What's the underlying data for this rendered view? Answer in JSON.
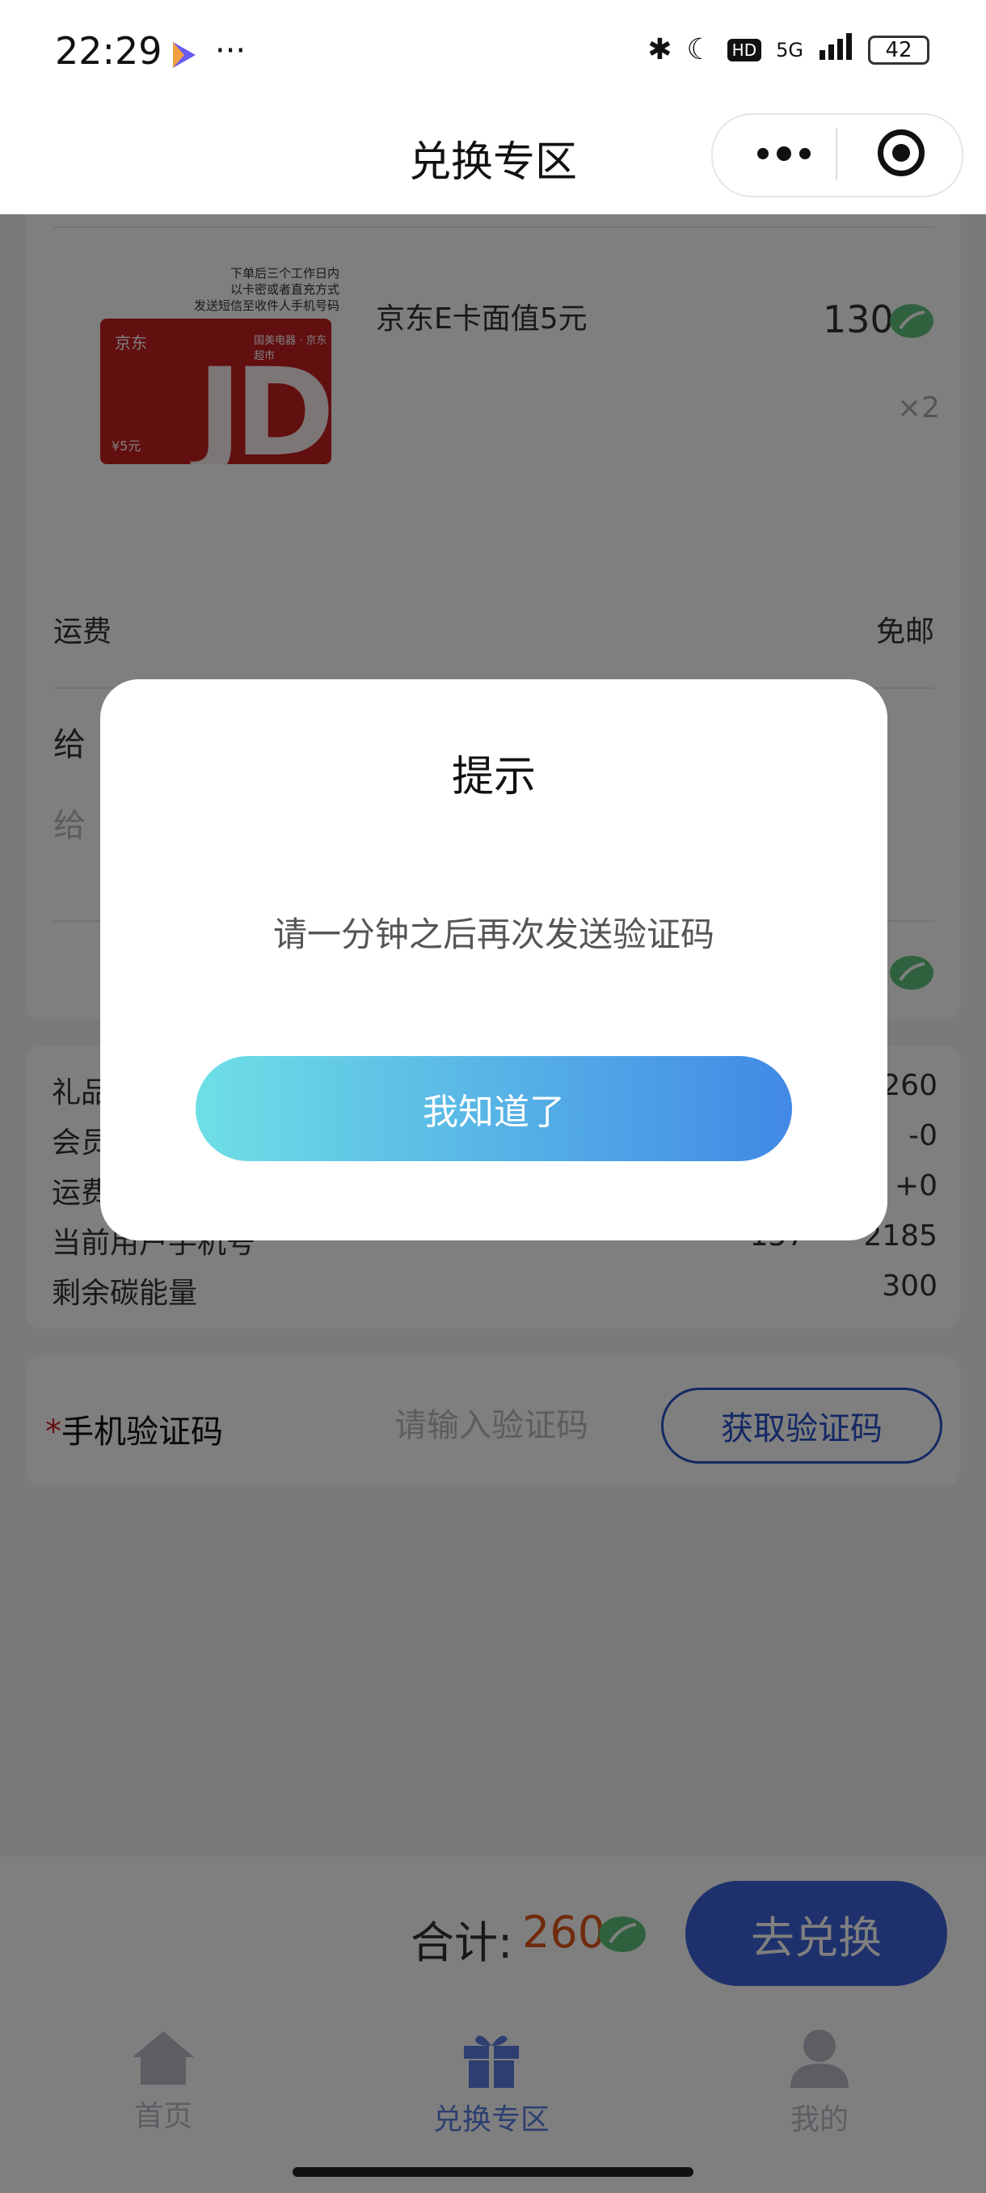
{
  "status": {
    "time": "22:29",
    "battery": "42",
    "network": "5G",
    "hd": "HD"
  },
  "nav": {
    "title": "兑换专区"
  },
  "product": {
    "card_note": [
      "下单后三个工作日内",
      "以卡密或者直充方式",
      "发送短信至收件人手机号码"
    ],
    "card_logo": "京东",
    "card_brand": "JD",
    "card_value_small": "¥5元",
    "card_tags": "国美电器 · 京东超市",
    "name": "京东E卡面值5元",
    "price": "130",
    "quantity": "×2"
  },
  "shipping": {
    "label": "运费",
    "value": "免邮"
  },
  "message": {
    "label": "给",
    "placeholder": "给"
  },
  "summary": {
    "rows": [
      {
        "label": "礼品",
        "value": "260"
      },
      {
        "label": "会员",
        "value": "-0"
      },
      {
        "label": "运费",
        "value": "+0"
      },
      {
        "label": "当前用户手机号",
        "value": "157****2185"
      },
      {
        "label": "剩余碳能量",
        "value": "300"
      }
    ]
  },
  "verify": {
    "star": "*",
    "label": "手机验证码",
    "placeholder": "请输入验证码",
    "button": "获取验证码"
  },
  "checkout": {
    "total_label": "合计:",
    "total_value": "260",
    "button": "去兑换"
  },
  "tabs": [
    {
      "label": "首页",
      "active": false,
      "icon": "home-icon"
    },
    {
      "label": "兑换专区",
      "active": true,
      "icon": "gift-icon"
    },
    {
      "label": "我的",
      "active": false,
      "icon": "user-icon"
    }
  ],
  "dialog": {
    "title": "提示",
    "message": "请一分钟之后再次发送验证码",
    "button": "我知道了"
  },
  "colors": {
    "accent": "#3d63d8",
    "price": "#e0561b",
    "leaf": "#5fc27d",
    "tab_active": "#5b7fe0",
    "tab_inactive": "#b9bcc6"
  }
}
